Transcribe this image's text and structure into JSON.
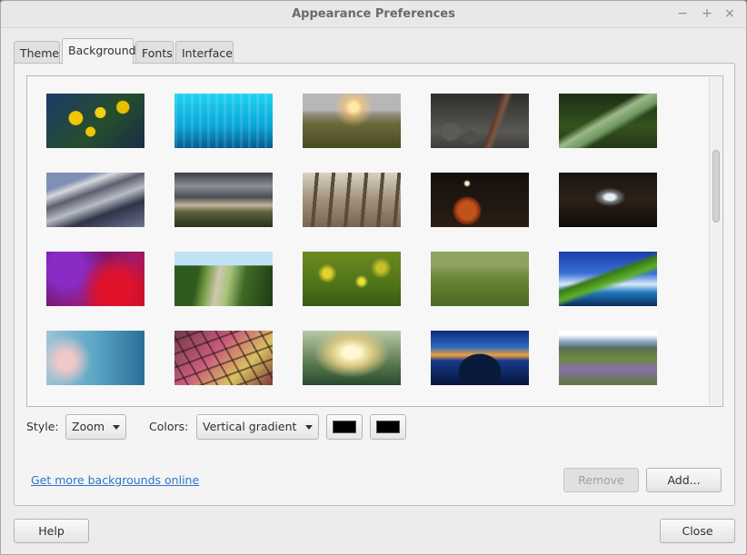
{
  "window": {
    "title": "Appearance Preferences",
    "controls": {
      "minimize": "−",
      "maximize": "+",
      "close": "×"
    }
  },
  "tabs": [
    {
      "label": "Theme",
      "active": false
    },
    {
      "label": "Background",
      "active": true
    },
    {
      "label": "Fonts",
      "active": false
    },
    {
      "label": "Interface",
      "active": false
    }
  ],
  "gallery": {
    "thumbnails": [
      {
        "subject": "yellow daffodils"
      },
      {
        "subject": "cyan light streaks"
      },
      {
        "subject": "sunset over grass"
      },
      {
        "subject": "pebbles and leaf"
      },
      {
        "subject": "dew on green leaf"
      },
      {
        "subject": "curved modern architecture"
      },
      {
        "subject": "cloudy mountain sky"
      },
      {
        "subject": "wooden fence in grass"
      },
      {
        "subject": "candle in apple"
      },
      {
        "subject": "dark hallway with window"
      },
      {
        "subject": "purple red abstract"
      },
      {
        "subject": "garden path"
      },
      {
        "subject": "blurred meadow flowers"
      },
      {
        "subject": "green field"
      },
      {
        "subject": "coastal cliff and sky"
      },
      {
        "subject": "blue blurred bokeh"
      },
      {
        "subject": "colored glass facade"
      },
      {
        "subject": "blurred warm light"
      },
      {
        "subject": "lake at dusk"
      },
      {
        "subject": "mountain valley flowers"
      }
    ]
  },
  "style": {
    "label": "Style:",
    "value": "Zoom"
  },
  "colors": {
    "label": "Colors:",
    "value": "Vertical gradient",
    "primary": "#000000",
    "secondary": "#000000"
  },
  "links": {
    "more_backgrounds": "Get more backgrounds online"
  },
  "buttons": {
    "remove": "Remove",
    "add": "Add...",
    "help": "Help",
    "close": "Close"
  }
}
